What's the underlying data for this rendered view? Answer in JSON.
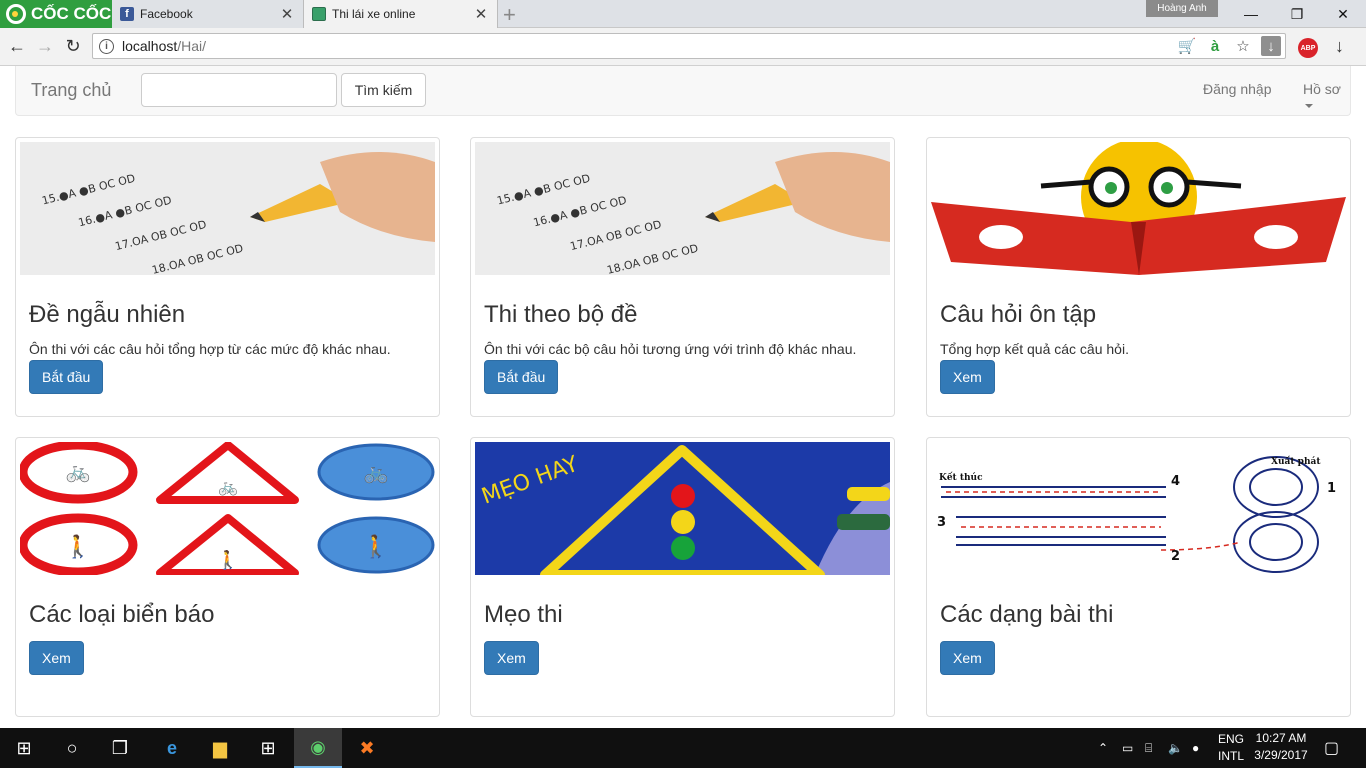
{
  "browser": {
    "brand": "CỐC CỐC",
    "tabs": [
      {
        "title": "Facebook",
        "favicon": "facebook-favicon"
      },
      {
        "title": "Thi lái xe online",
        "favicon": "site-favicon",
        "active": true
      }
    ],
    "user_name": "Hoàng Anh",
    "url_host": "localhost",
    "url_path": "/Hai/"
  },
  "navbar": {
    "home": "Trang chủ",
    "search_placeholder": "",
    "search_button": "Tìm kiếm",
    "login": "Đăng nhập",
    "profile": "Hồ sơ"
  },
  "cards": [
    {
      "title": "Đề ngẫu nhiên",
      "description": "Ôn thi với các câu hỏi tổng hợp từ các mức độ khác nhau.",
      "button": "Bắt đầu",
      "image": "answer-sheet-image"
    },
    {
      "title": "Thi theo bộ đề",
      "description": "Ôn thi với các bộ câu hỏi tương ứng với trình độ khác nhau.",
      "button": "Bắt đầu",
      "image": "answer-sheet-image"
    },
    {
      "title": "Câu hỏi ôn tập",
      "description": "Tổng hợp kết quả các câu hỏi.",
      "button": "Xem",
      "image": "reading-smiley-image"
    },
    {
      "title": "Các loại biển báo",
      "description": "",
      "button": "Xem",
      "image": "traffic-signs-image"
    },
    {
      "title": "Mẹo thi",
      "description": "",
      "button": "Xem",
      "image": "exam-tips-image"
    },
    {
      "title": "Các dạng bài thi",
      "description": "",
      "button": "Xem",
      "image": "driving-course-image"
    }
  ],
  "images": {
    "answer_sheet_rows": [
      "15.●A ●B OC OD",
      "16.●A ●B OC OD",
      "17.OA OB OC OD",
      "18.OA OB OC OD"
    ],
    "tips_text": "MẸO HAY",
    "course_labels": {
      "end": "Kết thúc",
      "start": "Xuất phát",
      "n1": "1",
      "n2": "2",
      "n3": "3",
      "n4": "4"
    }
  },
  "taskbar": {
    "lang_top": "ENG",
    "lang_bottom": "INTL",
    "time": "10:27 AM",
    "date": "3/29/2017"
  },
  "colors": {
    "brand_green": "#2f9e3f",
    "primary_button": "#337ab7",
    "navbar_bg": "#f8f8f8",
    "taskbar_bg": "#101010"
  }
}
